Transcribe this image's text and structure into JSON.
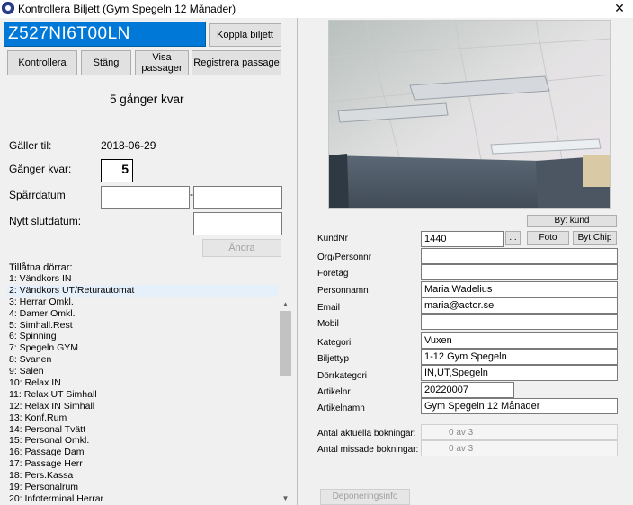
{
  "window": {
    "title": "Kontrollera Biljett  (Gym Spegeln 12 Månader)",
    "close_glyph": "✕"
  },
  "ticket": {
    "code": "Z527NI6T00LN"
  },
  "buttons": {
    "koppla": "Koppla biljett",
    "kontrollera": "Kontrollera",
    "stang": "Stäng",
    "visa_passager": "Visa\npassager",
    "registrera": "Registrera passage",
    "andra": "Ändra",
    "byt_kund": "Byt kund",
    "ellipsis": "...",
    "foto": "Foto",
    "byt_chip": "Byt Chip",
    "deponeringsinfo": "Deponeringsinfo"
  },
  "status": {
    "remaining_text": "5 gånger kvar"
  },
  "validity": {
    "galler_till_label": "Gäller til:",
    "galler_till_value": "2018-06-29",
    "ganger_kvar_label": "Gånger kvar:",
    "ganger_kvar_value": "5",
    "sparrdatum_label": "Spärrdatum",
    "sparrdatum_sep": "-",
    "nytt_slutdatum_label": "Nytt slutdatum:"
  },
  "doors": {
    "title": "Tillåtna dörrar:",
    "items": [
      "1: Vändkors IN",
      "2: Vändkors UT/Returautomat",
      "3: Herrar Omkl.",
      "4: Damer Omkl.",
      "5: Simhall.Rest",
      "6: Spinning",
      "7: Spegeln GYM",
      "8: Svanen",
      "9: Sälen",
      "10: Relax IN",
      "11: Relax UT Simhall",
      "12: Relax IN Simhall",
      "13: Konf.Rum",
      "14: Personal Tvätt",
      "15: Personal Omkl.",
      "16: Passage Dam",
      "17: Passage Herr",
      "18: Pers.Kassa",
      "19: Personalrum",
      "20: Infoterminal Herrar"
    ]
  },
  "customer": {
    "kundnr_label": "KundNr",
    "kundnr": "1440",
    "org_label": "Org/Personnr",
    "org": "",
    "foretag_label": "Företag",
    "foretag": "",
    "namn_label": "Personnamn",
    "namn": "Maria Wadelius",
    "email_label": "Email",
    "email": "maria@actor.se",
    "mobil_label": "Mobil",
    "mobil": "",
    "kategori_label": "Kategori",
    "kategori": "Vuxen",
    "biljettyp_label": "Biljettyp",
    "biljettyp": "1-12 Gym Spegeln",
    "dorrkategori_label": "Dörrkategori",
    "dorrkategori": "IN,UT,Spegeln",
    "artikelnr_label": "Artikelnr",
    "artikelnr": "20220007",
    "artikelnamn_label": "Artikelnamn",
    "artikelnamn": "Gym Spegeln 12 Månader"
  },
  "bookings": {
    "aktuella_label": "Antal aktuella bokningar:",
    "aktuella": "0 av 3",
    "missade_label": "Antal missade bokningar:",
    "missade": "0 av 3"
  }
}
